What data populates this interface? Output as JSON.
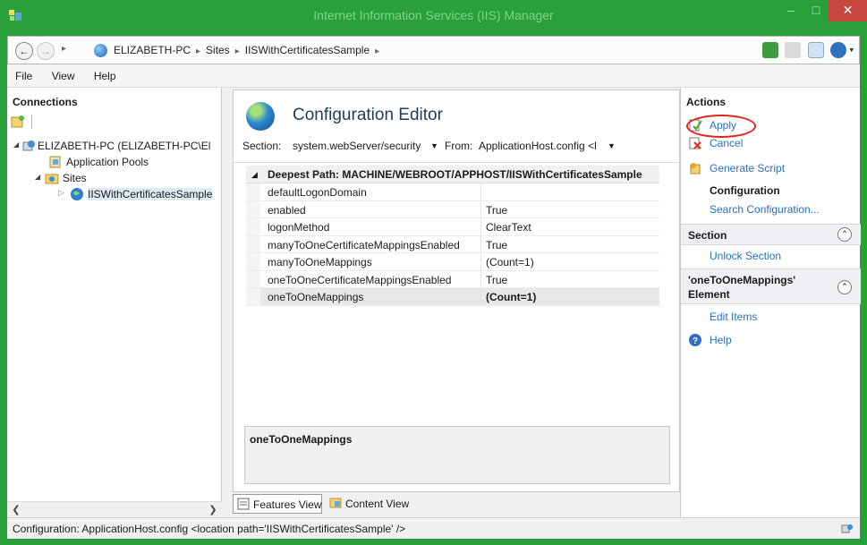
{
  "window": {
    "title": "Internet Information Services (IIS) Manager"
  },
  "address": {
    "crumbs": [
      "ELIZABETH-PC",
      "Sites",
      "IISWithCertificatesSample"
    ]
  },
  "menu": {
    "file": "File",
    "view": "View",
    "help": "Help"
  },
  "connections": {
    "title": "Connections",
    "tree": {
      "server": "ELIZABETH-PC (ELIZABETH-PC\\El",
      "app_pools": "Application Pools",
      "sites": "Sites",
      "site": "IISWithCertificatesSample"
    }
  },
  "editor": {
    "title": "Configuration Editor",
    "section_label": "Section:",
    "section_value": "system.webServer/security",
    "from_label": "From:",
    "from_value": "ApplicationHost.config <l",
    "grid_header": "Deepest Path: MACHINE/WEBROOT/APPHOST/IISWithCertificatesSample",
    "rows": [
      {
        "key": "defaultLogonDomain",
        "value": ""
      },
      {
        "key": "enabled",
        "value": "True"
      },
      {
        "key": "logonMethod",
        "value": "ClearText"
      },
      {
        "key": "manyToOneCertificateMappingsEnabled",
        "value": "True"
      },
      {
        "key": "manyToOneMappings",
        "value": "(Count=1)"
      },
      {
        "key": "oneToOneCertificateMappingsEnabled",
        "value": "True"
      },
      {
        "key": "oneToOneMappings",
        "value": "(Count=1)"
      }
    ],
    "description": "oneToOneMappings",
    "tabs": {
      "features": "Features View",
      "content": "Content View"
    }
  },
  "actions": {
    "title": "Actions",
    "apply": "Apply",
    "cancel": "Cancel",
    "generate_script": "Generate Script",
    "configuration": "Configuration",
    "search_configuration": "Search Configuration...",
    "section_header": "Section",
    "unlock_section": "Unlock Section",
    "element_header_1": "'oneToOneMappings'",
    "element_header_2": "Element",
    "edit_items": "Edit Items",
    "help": "Help"
  },
  "status": {
    "text": "Configuration: ApplicationHost.config <location path='IISWithCertificatesSample' />"
  },
  "colors": {
    "title_bar": "#2aa03a",
    "close_button": "#c7473e",
    "link": "#2a6fba",
    "highlight_circle": "#e0241c"
  }
}
